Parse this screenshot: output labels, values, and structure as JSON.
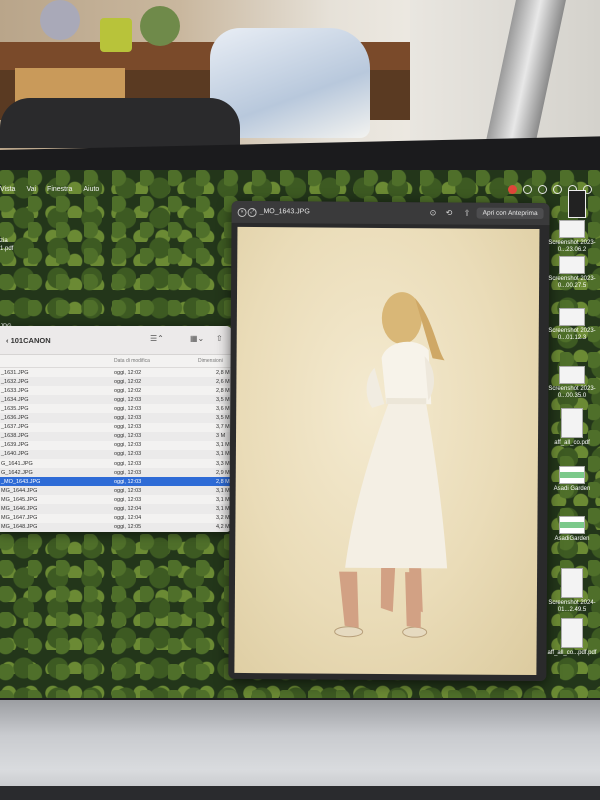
{
  "menubar": {
    "items": [
      "Vista",
      "Vai",
      "Finestra",
      "Aiuto"
    ]
  },
  "desktop_left": {
    "labels": [
      "zia",
      "1.pdf",
      "JPG"
    ]
  },
  "finder": {
    "title": "101CANON",
    "columns": {
      "name": "",
      "date": "Data di modifica",
      "size": "Dimensioni"
    },
    "rows": [
      {
        "name": "_1631.JPG",
        "date": "oggi, 12:02",
        "size": "2,8 M"
      },
      {
        "name": "_1632.JPG",
        "date": "oggi, 12:02",
        "size": "2,6 M"
      },
      {
        "name": "_1633.JPG",
        "date": "oggi, 12:02",
        "size": "2,8 M"
      },
      {
        "name": "_1634.JPG",
        "date": "oggi, 12:03",
        "size": "3,5 M"
      },
      {
        "name": "_1635.JPG",
        "date": "oggi, 12:03",
        "size": "3,6 M"
      },
      {
        "name": "_1636.JPG",
        "date": "oggi, 12:03",
        "size": "3,5 M"
      },
      {
        "name": "_1637.JPG",
        "date": "oggi, 12:03",
        "size": "3,7 M"
      },
      {
        "name": "_1638.JPG",
        "date": "oggi, 12:03",
        "size": "3 M"
      },
      {
        "name": "_1639.JPG",
        "date": "oggi, 12:03",
        "size": "3,1 M"
      },
      {
        "name": "_1640.JPG",
        "date": "oggi, 12:03",
        "size": "3,1 M"
      },
      {
        "name": "G_1641.JPG",
        "date": "oggi, 12:03",
        "size": "3,3 M"
      },
      {
        "name": "G_1642.JPG",
        "date": "oggi, 12:03",
        "size": "2,9 M"
      },
      {
        "name": "_MO_1643.JPG",
        "date": "oggi, 12:03",
        "size": "2,8 M",
        "selected": true
      },
      {
        "name": "MG_1644.JPG",
        "date": "oggi, 12:03",
        "size": "3,1 M"
      },
      {
        "name": "MG_1645.JPG",
        "date": "oggi, 12:03",
        "size": "3,1 M"
      },
      {
        "name": "MG_1646.JPG",
        "date": "oggi, 12:04",
        "size": "3,1 M"
      },
      {
        "name": "MG_1647.JPG",
        "date": "oggi, 12:04",
        "size": "3,2 M"
      },
      {
        "name": "MG_1648.JPG",
        "date": "oggi, 12:05",
        "size": "4,2 M"
      }
    ]
  },
  "preview": {
    "title": "_MO_1643.JPG",
    "open_with": "Apri con Anteprima"
  },
  "desktop_right": {
    "icons": [
      {
        "label": "Screenshot 2023-0...23.06.2"
      },
      {
        "label": "Screenshot 2023-0...00.27.5"
      },
      {
        "label": "Screenshot 2023-0...01.12.3"
      },
      {
        "label": "Screenshot 2023-0...00.35.0"
      },
      {
        "label": "aff_all_co.pdf"
      },
      {
        "label": "Asadi Garden"
      },
      {
        "label": "AsadiGarden"
      },
      {
        "label": "Screenshot 2024-01...2.49.5"
      },
      {
        "label": "aff_all_co...pdf.pdf"
      }
    ]
  },
  "colors": {
    "selection": "#2e6bd6",
    "finder_bg": "#f3f2f1",
    "preview_bg": "#2a2a2b"
  }
}
